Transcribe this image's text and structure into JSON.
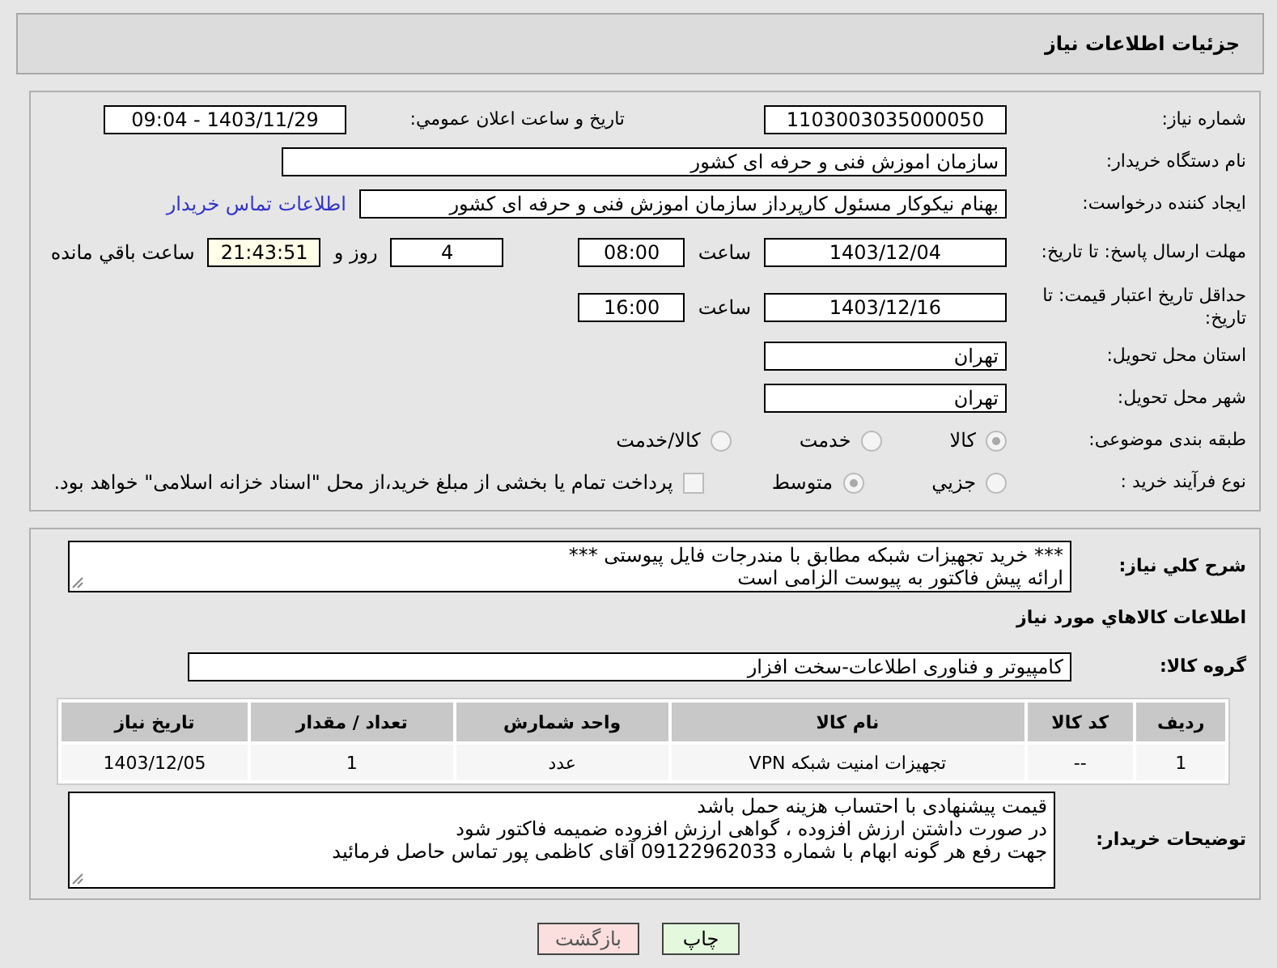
{
  "header": {
    "title": "جزئیات اطلاعات نیاز"
  },
  "need_number": {
    "label": "شماره نیاز:",
    "value": "1103003035000050"
  },
  "announcement": {
    "label": "تاریخ و ساعت اعلان عمومي:",
    "value": "1403/11/29 - 09:04"
  },
  "buyer_org": {
    "label": "نام دستگاه خریدار:",
    "value": "سازمان اموزش فنی و حرفه ای کشور"
  },
  "creator": {
    "label": "ایجاد کننده درخواست:",
    "value": "بهنام نیکوکار مسئول کارپرداز سازمان اموزش فنی و حرفه ای کشور",
    "link": "اطلاعات تماس خریدار"
  },
  "reply_deadline": {
    "label": "مهلت ارسال پاسخ: تا تاریخ:",
    "date": "1403/12/04",
    "time_label": "ساعت",
    "time": "08:00",
    "days": "4",
    "days_label": "روز و",
    "remaining": "21:43:51",
    "remaining_label": "ساعت باقي مانده"
  },
  "price_validity": {
    "label": "حداقل تاریخ اعتبار قیمت: تا تاریخ:",
    "date": "1403/12/16",
    "time_label": "ساعت",
    "time": "16:00"
  },
  "province": {
    "label": "استان محل تحویل:",
    "value": "تهران"
  },
  "city": {
    "label": "شهر محل تحویل:",
    "value": "تهران"
  },
  "category": {
    "label": "طبقه بندی موضوعی:",
    "options": [
      {
        "label": "کالا",
        "selected": true
      },
      {
        "label": "خدمت",
        "selected": false
      },
      {
        "label": "کالا/خدمت",
        "selected": false
      }
    ]
  },
  "process": {
    "label": "نوع فرآیند خرید :",
    "options": [
      {
        "label": "جزيي",
        "selected": false
      },
      {
        "label": "متوسط",
        "selected": true
      }
    ],
    "treasury": {
      "checked": false,
      "text": "پرداخت تمام یا بخشی از مبلغ خرید،از محل \"اسناد خزانه اسلامی\" خواهد بود."
    }
  },
  "description": {
    "label": "شرح كلي نياز:",
    "lines": [
      "*** خرید تجهیزات شبکه مطابق با مندرجات فایل پیوستی ***",
      "ارائه پیش فاکتور به پیوست الزامی است"
    ]
  },
  "goods_heading": "اطلاعات كالاهاي مورد نياز",
  "goods_group": {
    "label": "گروه کالا:",
    "value": "کامپیوتر و فناوری اطلاعات-سخت افزار"
  },
  "table": {
    "columns": [
      "ردیف",
      "کد کالا",
      "نام کالا",
      "واحد شمارش",
      "تعداد / مقدار",
      "تاریخ نیاز"
    ],
    "rows": [
      [
        "1",
        "--",
        "تجهیزات امنیت شبکه VPN",
        "عدد",
        "1",
        "1403/12/05"
      ]
    ]
  },
  "buyer_notes": {
    "label": "توضیحات خریدار:",
    "lines": [
      "قیمت پیشنهادی با احتساب هزینه حمل باشد",
      "در صورت داشتن ارزش افزوده ، گواهی ارزش افزوده ضمیمه فاکتور شود",
      "جهت رفع هر گونه ابهام با شماره 09122962033 آقای کاظمی پور تماس حاصل فرمائید"
    ]
  },
  "buttons": [
    {
      "kind": "print",
      "label": "چاپ"
    },
    {
      "kind": "back",
      "label": "بازگشت"
    }
  ]
}
